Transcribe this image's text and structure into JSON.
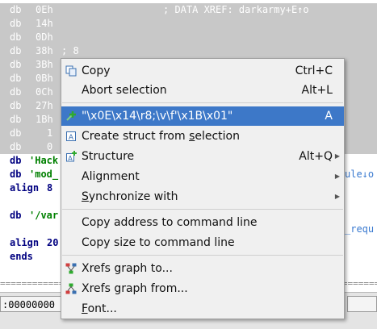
{
  "listing": {
    "rows": [
      {
        "kw": "db",
        "val": "0Eh",
        "comment": "; DATA XREF: darkarmy+E↑o"
      },
      {
        "kw": "db",
        "val": "14h"
      },
      {
        "kw": "db",
        "val": "0Dh"
      },
      {
        "kw": "db",
        "val": "38h",
        "extra": "; 8"
      },
      {
        "kw": "db",
        "val": "3Bh"
      },
      {
        "kw": "db",
        "val": "0Bh"
      },
      {
        "kw": "db",
        "val": "0Ch"
      },
      {
        "kw": "db",
        "val": "27h"
      },
      {
        "kw": "db",
        "val": "1Bh"
      },
      {
        "kw": "db",
        "val": "1"
      },
      {
        "kw": "db",
        "val": "0"
      }
    ],
    "lower": [
      {
        "kw": "db",
        "str": "'Hack"
      },
      {
        "kw": "db",
        "str": "'mod_"
      },
      {
        "kw": "align",
        "val": "8"
      },
      {
        "kw": "db",
        "str": "'/var"
      },
      {
        "kw": "align",
        "val": "20"
      },
      {
        "kw": "ends"
      }
    ],
    "right_fragments": [
      "ule↓o",
      "_requ"
    ],
    "top_fragment": "_",
    "separator": "====================================================================================",
    "address_field": ":00000000"
  },
  "menu": {
    "items": [
      {
        "id": "copy",
        "label": "Copy",
        "shortcut": "Ctrl+C",
        "icon": "copy-icon"
      },
      {
        "id": "abort",
        "label": "Abort selection",
        "shortcut": "Alt+L"
      },
      {
        "id": "string",
        "label": "\"\\x0E\\x14\\r8;\\v\\f'\\x1B\\x01\"",
        "shortcut": "A",
        "icon": "string-icon",
        "highlighted": true
      },
      {
        "id": "create-struct",
        "label": "Create struct from selection",
        "icon": "struct-create-icon"
      },
      {
        "id": "structure",
        "label": "Structure",
        "shortcut": "Alt+Q",
        "icon": "structure-icon",
        "submenu": true
      },
      {
        "id": "alignment",
        "label": "Alignment",
        "submenu": true
      },
      {
        "id": "synchronize",
        "label": "Synchronize with",
        "submenu": true
      },
      {
        "id": "copy-address",
        "label": "Copy address to command line"
      },
      {
        "id": "copy-size",
        "label": "Copy size to command line"
      },
      {
        "id": "xrefs-to",
        "label": "Xrefs graph to...",
        "icon": "xrefs-to-icon"
      },
      {
        "id": "xrefs-from",
        "label": "Xrefs graph from...",
        "icon": "xrefs-from-icon"
      },
      {
        "id": "font",
        "label": "Font..."
      }
    ]
  },
  "colors": {
    "highlight": "#3d78c8",
    "selection": "#c8c8c8",
    "keyword": "#000080",
    "string": "#008000"
  }
}
